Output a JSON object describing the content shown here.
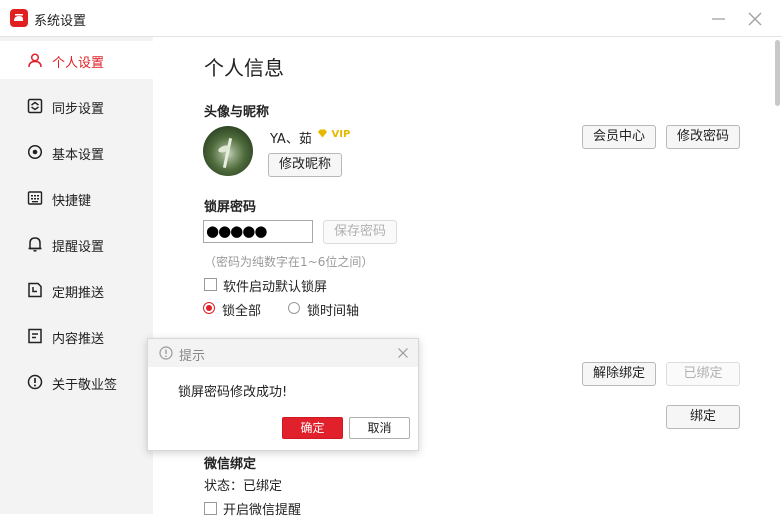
{
  "window": {
    "title": "系统设置"
  },
  "sidebar": {
    "items": [
      {
        "label": "个人设置",
        "icon": "user-icon",
        "active": true
      },
      {
        "label": "同步设置",
        "icon": "sync-icon"
      },
      {
        "label": "基本设置",
        "icon": "settings-icon"
      },
      {
        "label": "快捷键",
        "icon": "keyboard-icon"
      },
      {
        "label": "提醒设置",
        "icon": "bell-icon"
      },
      {
        "label": "定期推送",
        "icon": "schedule-icon"
      },
      {
        "label": "内容推送",
        "icon": "content-icon"
      },
      {
        "label": "关于敬业签",
        "icon": "info-icon"
      }
    ]
  },
  "main": {
    "title": "个人信息",
    "avatar_section": {
      "heading": "头像与昵称",
      "nickname": "YA、茹",
      "vip": "VIP",
      "edit_nickname": "修改昵称",
      "member_center": "会员中心",
      "change_password": "修改密码"
    },
    "lock": {
      "heading": "锁屏密码",
      "password_mask": "●●●●●",
      "save_password": "保存密码",
      "hint": "（密码为纯数字在1~6位之间）",
      "auto_lock_label": "软件启动默认锁屏",
      "radio_all": "锁全部",
      "radio_timeline": "锁时间轴"
    },
    "binding": {
      "unbind": "解除绑定",
      "bound": "已绑定",
      "bind": "绑定"
    },
    "wechat": {
      "heading": "微信绑定",
      "status": "状态：已绑定",
      "reminder_label": "开启微信提醒"
    }
  },
  "dialog": {
    "title": "提示",
    "message": "锁屏密码修改成功!",
    "ok": "确定",
    "cancel": "取消"
  },
  "colors": {
    "accent": "#e0202a",
    "vip": "#e6b800"
  }
}
